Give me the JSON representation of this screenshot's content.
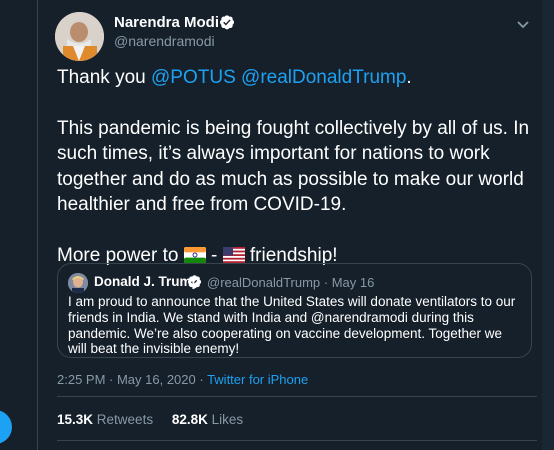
{
  "tweet": {
    "author_name": "Narendra Modi",
    "author_handle": "@narendramodi",
    "verified": true,
    "text_line1_prefix": "Thank you ",
    "mention1": "@POTUS",
    "mention2": "@realDonaldTrump",
    "text_line1_suffix": ".",
    "paragraph2": "This pandemic is being fought collectively by all of us. In such times, it’s always important for nations to work together and do as much as possible to make our world healthier and free from COVID-19.",
    "line3_prefix": "More power to ",
    "line3_mid": " - ",
    "line3_suffix": " friendship!",
    "timestamp": "2:25 PM · May 16, 2020 · ",
    "source": "Twitter for iPhone",
    "retweets_count": "15.3K",
    "retweets_label": "Retweets",
    "likes_count": "82.8K",
    "likes_label": "Likes"
  },
  "quoted_tweet": {
    "author_name": "Donald J. Trump",
    "meta": "@realDonaldTrump · May 16",
    "text": "I am proud to announce that the United States will donate ventilators to our friends in India. We stand with India and @narendramodi during this pandemic. We’re also cooperating on vaccine development. Together we will beat the invisible enemy!"
  },
  "colors": {
    "background": "#15202b",
    "accent": "#1da1f2",
    "secondary_text": "#8899a6",
    "border": "#38444d"
  },
  "icons": [
    "verified-badge-icon",
    "chevron-down-icon",
    "india-flag-icon",
    "usa-flag-icon"
  ]
}
